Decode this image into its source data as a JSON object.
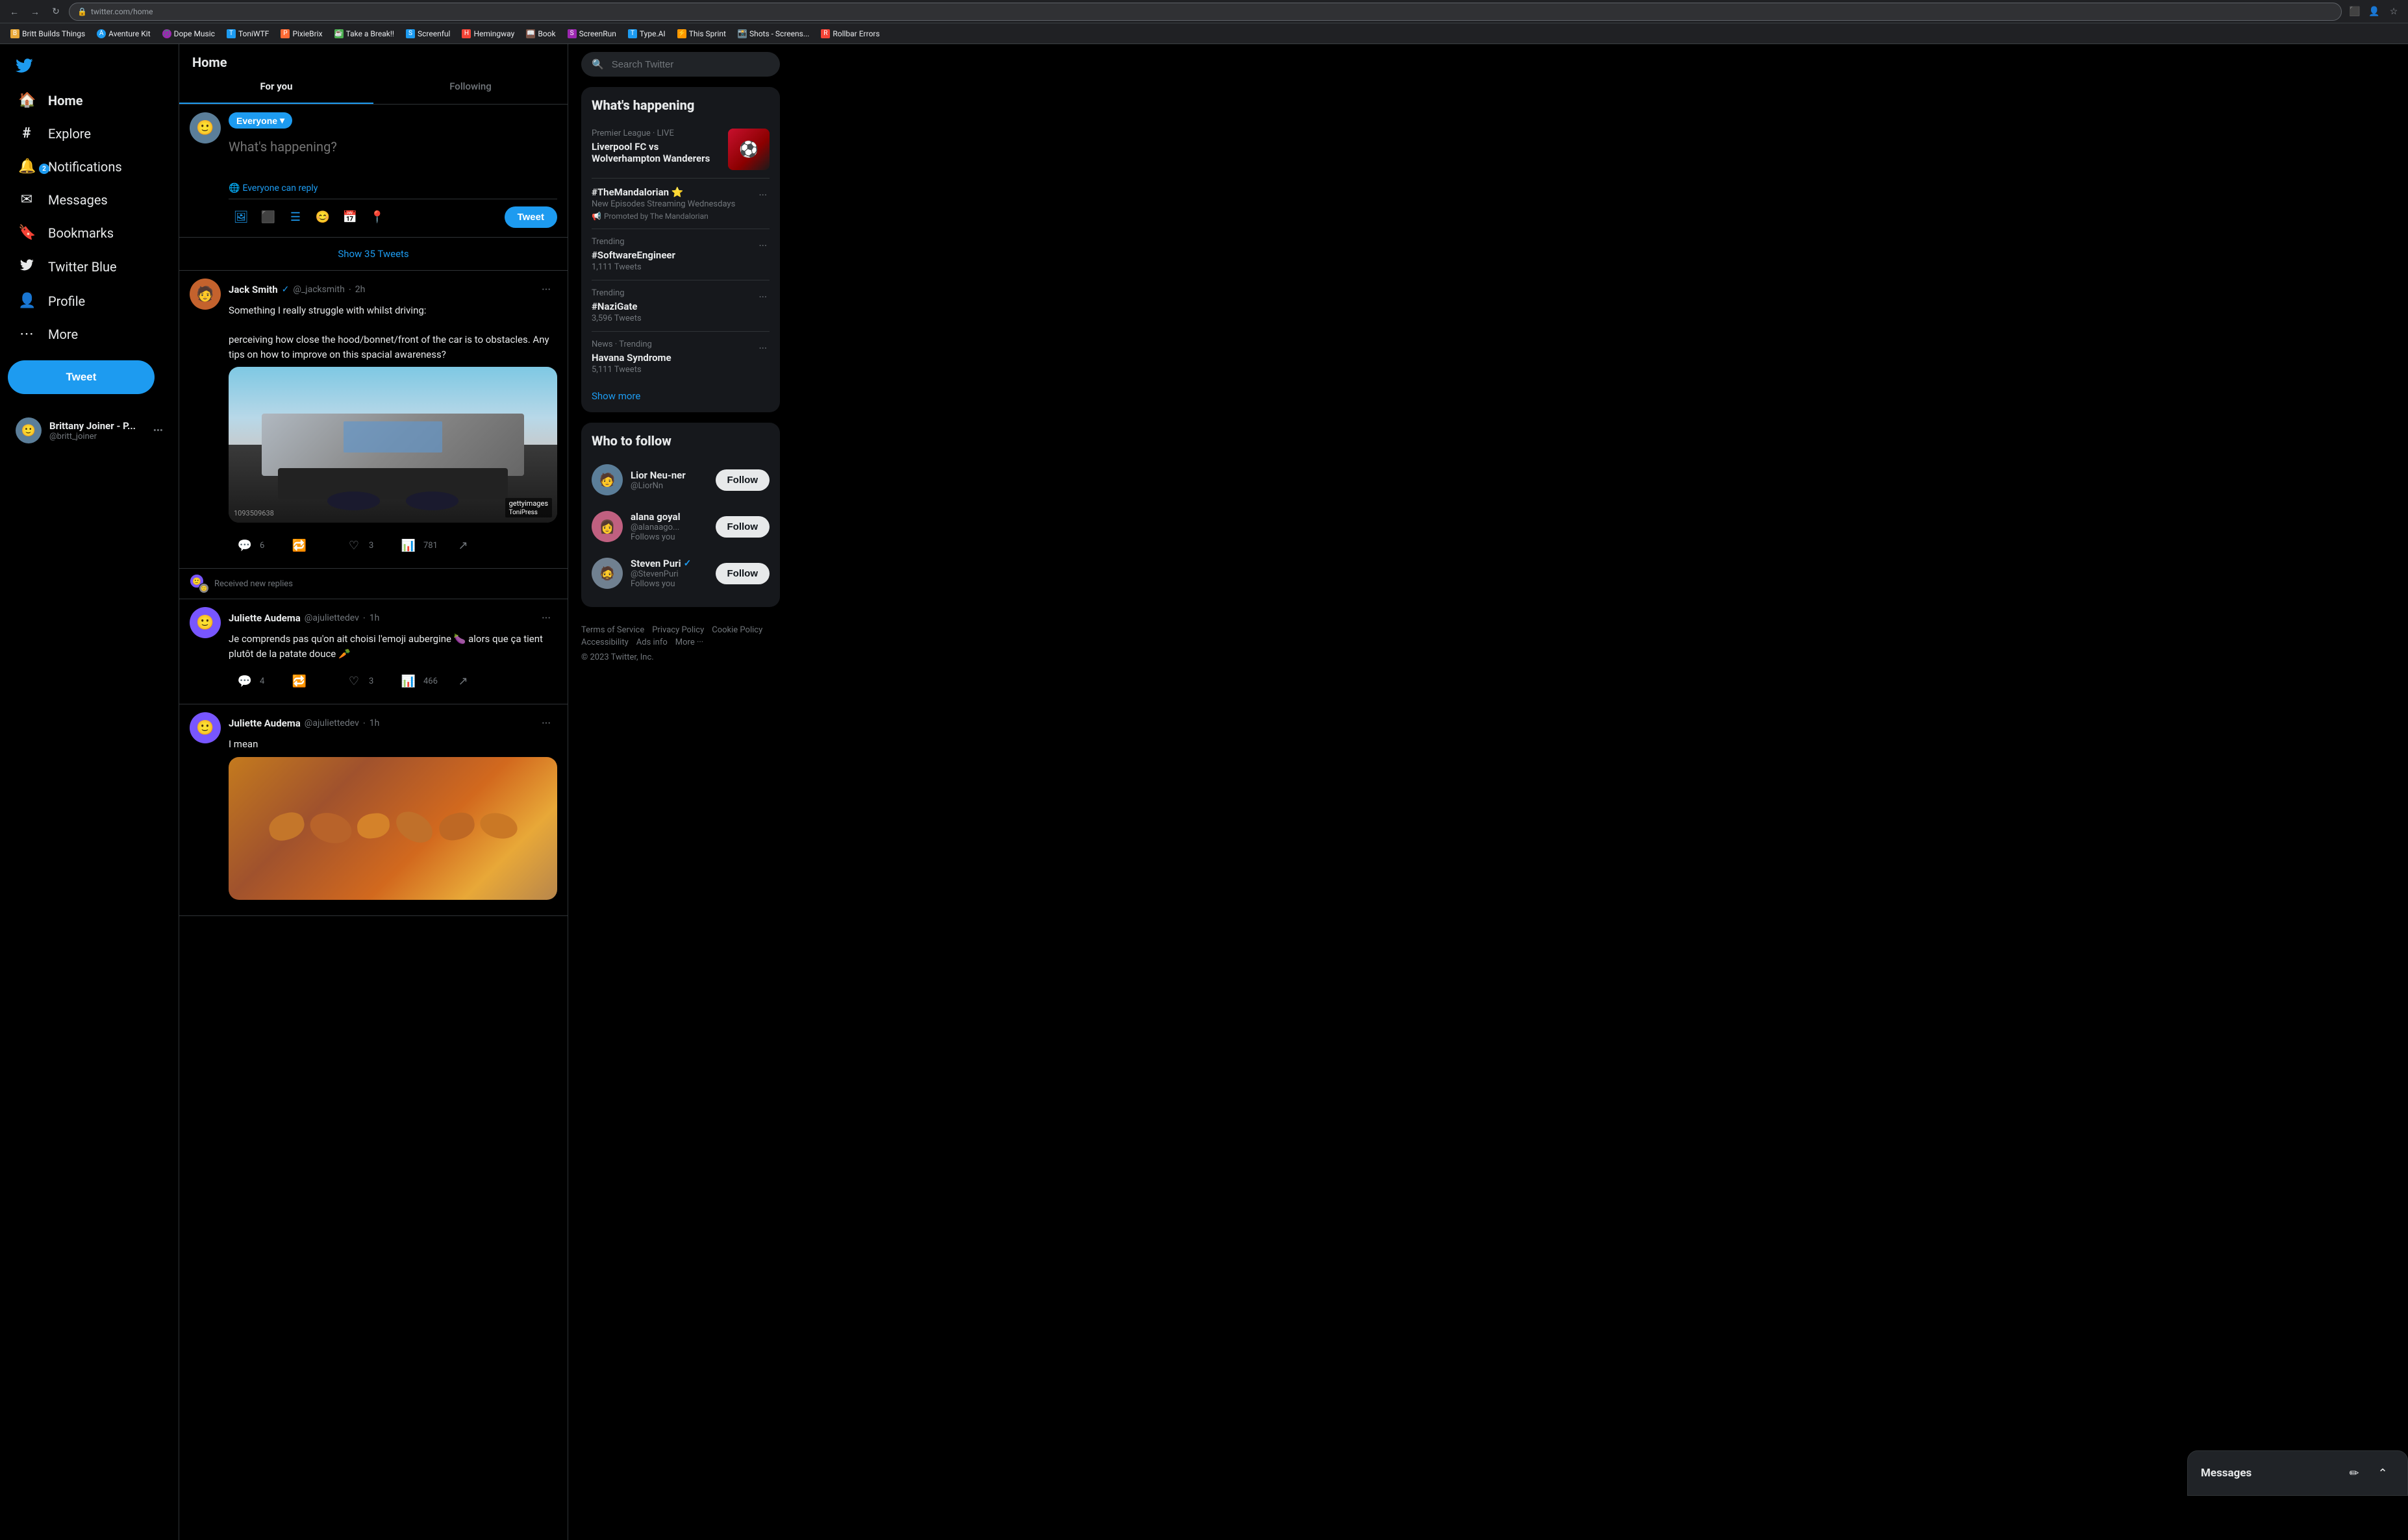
{
  "browser": {
    "url": "twitter.com/home",
    "nav_back": "←",
    "nav_forward": "→",
    "nav_refresh": "↻",
    "bookmarks": [
      {
        "label": "Britt Builds Things",
        "color": "#e8a838"
      },
      {
        "label": "Aventure Kit",
        "color": "#1d9bf0"
      },
      {
        "label": "Dope Music",
        "color": "#9c27b0"
      },
      {
        "label": "ToniWTF",
        "color": "#1d9bf0"
      },
      {
        "label": "PixieBrix",
        "color": "#ff6b35"
      },
      {
        "label": "Take a Break!!",
        "color": "#4caf50"
      },
      {
        "label": "Screenful",
        "color": "#1d9bf0"
      },
      {
        "label": "Hemingway",
        "color": "#f44336"
      },
      {
        "label": "Book",
        "color": "#795548"
      },
      {
        "label": "ScreenRun",
        "color": "#9c27b0"
      },
      {
        "label": "Type.AI",
        "color": "#1d9bf0"
      },
      {
        "label": "This Sprint",
        "color": "#ff9800"
      },
      {
        "label": "Shots - Screens...",
        "color": "#607d8b"
      },
      {
        "label": "Rollbar Errors",
        "color": "#f44336"
      }
    ]
  },
  "header": {
    "title": "Home"
  },
  "tabs": [
    {
      "label": "For you",
      "active": true
    },
    {
      "label": "Following",
      "active": false
    }
  ],
  "compose": {
    "audience_label": "Everyone",
    "audience_chevron": "▾",
    "placeholder": "What's happening?",
    "reply_label": "Everyone can reply",
    "tweet_button": "Tweet"
  },
  "show_tweets_banner": "Show 35 Tweets",
  "sidebar": {
    "items": [
      {
        "label": "Home",
        "icon": "🏠",
        "active": true,
        "badge": null
      },
      {
        "label": "Explore",
        "icon": "#",
        "active": false,
        "badge": null
      },
      {
        "label": "Notifications",
        "icon": "🔔",
        "active": false,
        "badge": "2"
      },
      {
        "label": "Messages",
        "icon": "✉",
        "active": false,
        "badge": null
      },
      {
        "label": "Bookmarks",
        "icon": "🔖",
        "active": false,
        "badge": null
      },
      {
        "label": "Twitter Blue",
        "icon": "◻",
        "active": false,
        "badge": null
      },
      {
        "label": "Profile",
        "icon": "👤",
        "active": false,
        "badge": null
      },
      {
        "label": "More",
        "icon": "⋯",
        "active": false,
        "badge": null
      }
    ],
    "tweet_button": "Tweet"
  },
  "tweets": [
    {
      "id": "tweet-1",
      "avatar_color": "#c4622d",
      "author_name": "Jack Smith",
      "verified": true,
      "handle": "@_jacksmith",
      "time": "2h",
      "text_lines": [
        "Something I really struggle with whilst driving:",
        "",
        "perceiving how close the hood/bonnet/front of the car is to obstacles. Any tips on how to improve on this spacial awareness?"
      ],
      "has_image": true,
      "image_type": "car",
      "image_watermark": "gettyimages",
      "image_source": "ToniPress",
      "image_id": "1093509638",
      "actions": {
        "reply_count": "6",
        "retweet_count": "",
        "like_count": "3",
        "views_count": "781"
      }
    },
    {
      "id": "tweet-2",
      "reply_notice": "Received new replies",
      "avatar_color": "#7856ff",
      "author_name": "Juliette Audema",
      "verified": false,
      "handle": "@ajuliettedev",
      "time": "1h",
      "text_lines": [
        "Je comprends pas qu'on ait choisi l'emoji aubergine 🍆 alors que ça tient plutôt de la patate douce 🥕"
      ],
      "has_image": false,
      "actions": {
        "reply_count": "4",
        "retweet_count": "",
        "like_count": "3",
        "views_count": "466"
      }
    },
    {
      "id": "tweet-3",
      "avatar_color": "#7856ff",
      "author_name": "Juliette Audema",
      "verified": false,
      "handle": "@ajuliettedev",
      "time": "1h",
      "text_lines": [
        "I mean"
      ],
      "has_image": true,
      "image_type": "sweet_potato",
      "actions": {
        "reply_count": "",
        "retweet_count": "",
        "like_count": "",
        "views_count": ""
      }
    }
  ],
  "sidebar_profile": {
    "name": "Brittany Joiner - P...",
    "handle": "@britt_joiner"
  },
  "right_sidebar": {
    "search_placeholder": "Search Twitter",
    "trending_title": "What's happening",
    "trending_items": [
      {
        "context": "Premier League · LIVE",
        "title": "Liverpool FC vs Wolverhampton Wanderers",
        "count": "",
        "has_image": true
      },
      {
        "context": "",
        "title": "#TheMandalorian 🌟",
        "count": "",
        "promoted": true,
        "promo_text": "New Episodes Streaming Wednesdays",
        "promo_by": "Promoted by The Mandalorian"
      },
      {
        "context": "Trending",
        "title": "#SoftwareEngineer",
        "count": "1,111 Tweets"
      },
      {
        "context": "Trending",
        "title": "#NaziGate",
        "count": "3,596 Tweets"
      },
      {
        "context": "News · Trending",
        "title": "Havana Syndrome",
        "count": "5,111 Tweets"
      }
    ],
    "show_more": "Show more",
    "who_to_follow_title": "Who to follow",
    "follow_accounts": [
      {
        "name": "Lior Neu-ner",
        "handle": "@LiorNn",
        "follows_you": false,
        "avatar_color": "#5b7e99"
      },
      {
        "name": "alana goyal",
        "handle": "@alanaago...",
        "follows_you": true,
        "follows_text": "Follows you",
        "avatar_color": "#c06080"
      },
      {
        "name": "Steven Puri",
        "handle": "@StevenPuri",
        "verified": true,
        "follows_you": true,
        "follows_text": "Follows you",
        "avatar_color": "#708090"
      }
    ],
    "follow_button": "Follow",
    "footer": {
      "links": [
        "Terms of Service",
        "Privacy Policy",
        "Cookie Policy",
        "Accessibility",
        "Ads info",
        "More ···"
      ],
      "copyright": "© 2023 Twitter, Inc."
    }
  },
  "messages_bar": {
    "title": "Messages",
    "action_compose": "✏",
    "action_chevron": "⌃"
  }
}
